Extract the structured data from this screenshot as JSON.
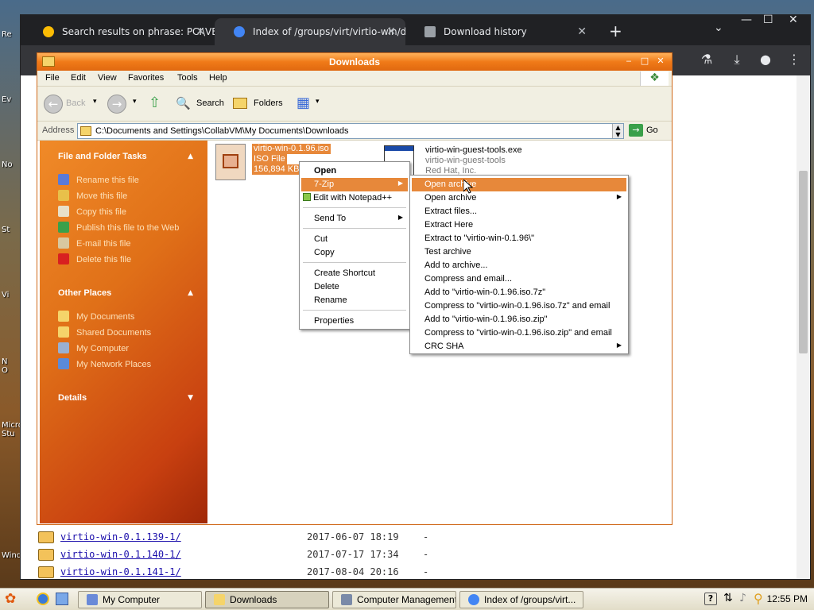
{
  "desktop": {
    "labels": [
      "Re",
      "Ev",
      "No",
      "St",
      "Vi",
      "N\nO",
      "Micro\nStu",
      "Wind"
    ]
  },
  "chrome": {
    "tabs": [
      {
        "label": "Search results on phrase: PCI\\VEN",
        "favicon_color": "#fbbc04"
      },
      {
        "label": "Index of /groups/virt/virtio-win/dir",
        "favicon_color": "#4285f4"
      },
      {
        "label": "Download history",
        "favicon_color": "#9aa0a6"
      }
    ],
    "close_glyph": "✕",
    "new_tab_glyph": "+",
    "tab_search_glyph": "⌄",
    "window_controls": {
      "minimize": "—",
      "maximize": "☐",
      "close": "✕"
    },
    "toolbar_icons": [
      "lab-icon",
      "download-icon",
      "profile-icon",
      "menu-icon"
    ],
    "toolbar_glyphs": {
      "lab": "⚗",
      "download": "⤓",
      "profile": "●",
      "menu": "⋮"
    },
    "listing": [
      {
        "name": "virtio-win-0.1.139-1/",
        "date": "2017-06-07 18:19",
        "size": "-"
      },
      {
        "name": "virtio-win-0.1.140-1/",
        "date": "2017-07-17 17:34",
        "size": "-"
      },
      {
        "name": "virtio-win-0.1.141-1/",
        "date": "2017-08-04 20:16",
        "size": "-"
      }
    ]
  },
  "explorer": {
    "title": "Downloads",
    "title_buttons": {
      "minimize": "‒",
      "maximize": "□",
      "close": "✕"
    },
    "menu": [
      "File",
      "Edit",
      "View",
      "Favorites",
      "Tools",
      "Help"
    ],
    "toolbar": {
      "back": "Back",
      "search": "Search",
      "folders": "Folders"
    },
    "toolbar_glyphs": {
      "back": "←",
      "forward": "→",
      "dropdown": "▾",
      "up": "⇧",
      "search": "🔍",
      "views": "▦"
    },
    "address_label": "Address",
    "address_value": "C:\\Documents and Settings\\CollabVM\\My Documents\\Downloads",
    "address_dropdown": "▲\n▼",
    "go_label": "Go",
    "go_glyph": "→",
    "task_pane": {
      "file_tasks_title": "File and Folder Tasks",
      "file_tasks": [
        {
          "label": "Rename this file",
          "icon_color": "#5a7ad8"
        },
        {
          "label": "Move this file",
          "icon_color": "#e8c04a"
        },
        {
          "label": "Copy this file",
          "icon_color": "#e8e0c8"
        },
        {
          "label": "Publish this file to the Web",
          "icon_color": "#3aa04a"
        },
        {
          "label": "E-mail this file",
          "icon_color": "#d8c8a0"
        },
        {
          "label": "Delete this file",
          "icon_color": "#d82020"
        }
      ],
      "other_places_title": "Other Places",
      "other_places": [
        {
          "label": "My Documents",
          "icon_color": "#f5d46a"
        },
        {
          "label": "Shared Documents",
          "icon_color": "#f5d46a"
        },
        {
          "label": "My Computer",
          "icon_color": "#9ab0d0"
        },
        {
          "label": "My Network Places",
          "icon_color": "#5a8ad8"
        }
      ],
      "details_title": "Details",
      "collapse_glyph": "▲",
      "expand_glyph": "▼"
    },
    "files": [
      {
        "name": "virtio-win-0.1.96.iso",
        "type": "ISO File",
        "size": "156,894 KB",
        "selected": true
      },
      {
        "name": "virtio-win-guest-tools.exe",
        "type": "virtio-win-guest-tools",
        "company": "Red Hat, Inc."
      }
    ]
  },
  "context_menu": {
    "items": [
      "Open",
      "7-Zip",
      "Edit with Notepad++",
      "Send To",
      "Cut",
      "Copy",
      "Create Shortcut",
      "Delete",
      "Rename",
      "Properties"
    ],
    "arrow_glyph": "▶"
  },
  "sevenzip_menu": {
    "items": [
      "Open archive",
      "Open archive",
      "Extract files...",
      "Extract Here",
      "Extract to \"virtio-win-0.1.96\\\"",
      "Test archive",
      "Add to archive...",
      "Compress and email...",
      "Add to \"virtio-win-0.1.96.iso.7z\"",
      "Compress to \"virtio-win-0.1.96.iso.7z\" and email",
      "Add to \"virtio-win-0.1.96.iso.zip\"",
      "Compress to \"virtio-win-0.1.96.iso.zip\" and email",
      "CRC SHA"
    ]
  },
  "taskbar": {
    "start_glyph": "✿",
    "buttons": [
      {
        "label": "My Computer",
        "icon_color": "#6a8ad8"
      },
      {
        "label": "Downloads",
        "icon_color": "#f5d46a"
      },
      {
        "label": "Computer Management",
        "icon_color": "#7a8aa8"
      },
      {
        "label": "Index of /groups/virt...",
        "icon_color": "#4285f4"
      }
    ],
    "tray_glyphs": {
      "help": "?",
      "network": "⇅",
      "volume": "♪",
      "search": "⚲"
    },
    "clock": "12:55 PM"
  }
}
